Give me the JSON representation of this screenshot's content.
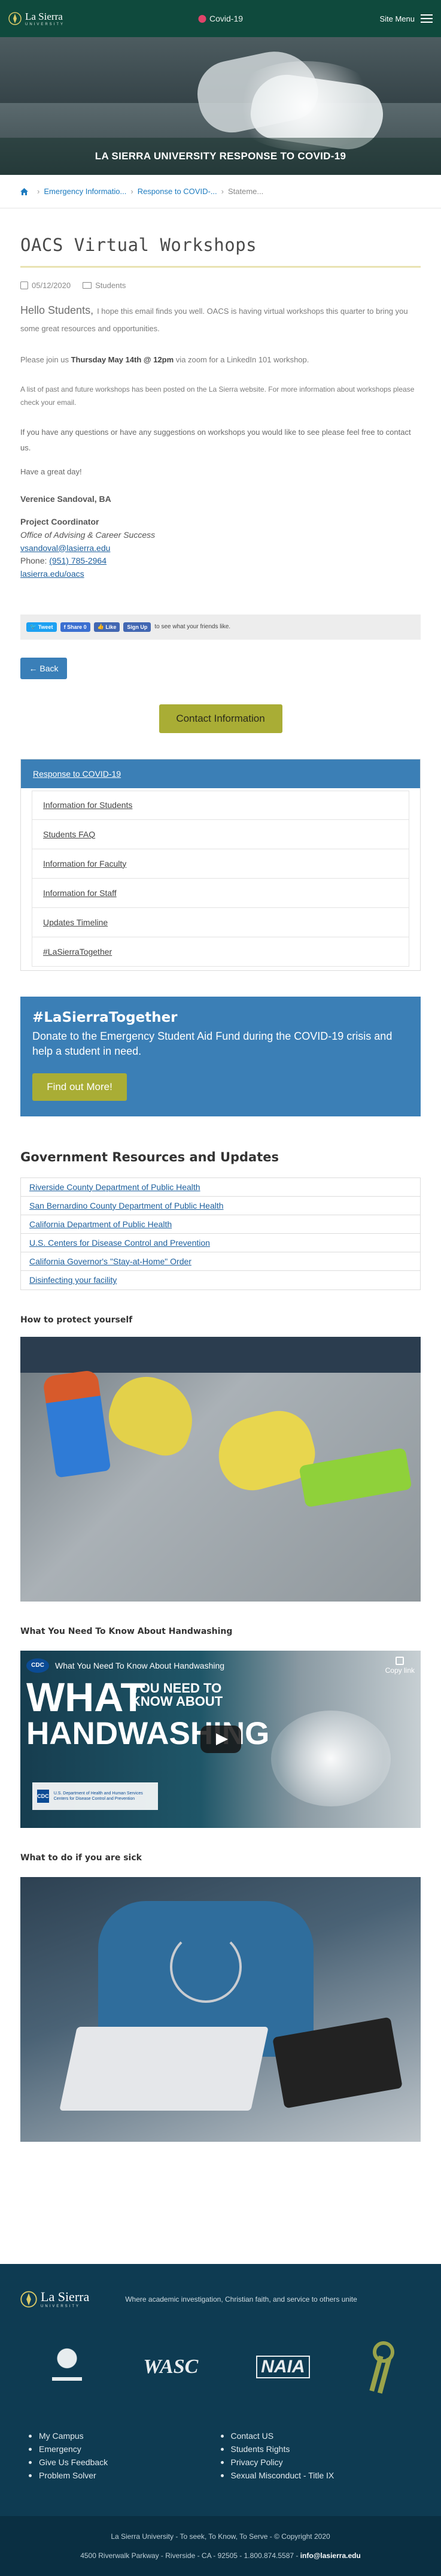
{
  "header": {
    "logo_name": "La Sierra",
    "logo_sub": "UNIVERSITY",
    "covid_label": "Covid-19",
    "menu_label": "Site Menu"
  },
  "hero": {
    "title": "LA SIERRA UNIVERSITY RESPONSE TO COVID-19"
  },
  "breadcrumb": {
    "items": [
      "Emergency Informatio...",
      "Response to COVID-...",
      "Stateme..."
    ]
  },
  "article": {
    "title": "OACS Virtual Workshops",
    "date": "05/12/2020",
    "category": "Students",
    "hello": "Hello Students,",
    "intro": "I hope this email finds you well. OACS is having virtual workshops this quarter to bring you some great resources and opportunities.",
    "join_prefix": "Please join us ",
    "join_bold": "Thursday May 14th @ 12pm",
    "join_suffix": " via zoom for a LinkedIn 101 workshop.",
    "list_text": "A list of past and future workshops has been posted on the La Sierra website. For more information about workshops please check your email.",
    "questions": "If you have any questions or have any suggestions on workshops you would like to see please feel free to contact us.",
    "closing": "Have a great day!",
    "signer": "Verenice Sandoval, BA",
    "role_title": "Project Coordinator",
    "office": "Office of Advising & Career Success",
    "email": "vsandoval@lasierra.edu",
    "phone_label": "Phone: ",
    "phone": "(951) 785-2964",
    "site": "lasierra.edu/oacs"
  },
  "share": {
    "tweet": "Tweet",
    "share": "Share 0",
    "like": "Like",
    "signup": "Sign Up",
    "fb_text": "to see what your friends like."
  },
  "buttons": {
    "back": "← Back",
    "contact": "Contact Information"
  },
  "sidenav": {
    "head": "Response to COVID-19",
    "items": [
      "Information for Students",
      "Students FAQ",
      "Information for Faculty",
      "Information for Staff",
      "Updates Timeline",
      "#LaSierraTogether"
    ]
  },
  "donate": {
    "tag": "#LaSierraTogether",
    "text": "Donate to the Emergency Student Aid Fund during the COVID-19 crisis and help a student in need.",
    "button": "Find out More!"
  },
  "resources": {
    "title": "Government Resources and Updates",
    "items": [
      "Riverside County Department of Public Health",
      "San Bernardino County Department of Public Health",
      "California Department of Public Health",
      "U.S. Centers for Disease Control and Prevention",
      "California Governor's \"Stay-at-Home\" Order",
      "Disinfecting your facility"
    ]
  },
  "sections": {
    "protect": "How to protect yourself",
    "handwash": "What You Need To Know About Handwashing",
    "sick": "What to do if you are sick"
  },
  "video": {
    "channel": "CDC",
    "title": "What You Need To Know About Handwashing",
    "copy_link": "Copy link",
    "big_what": "WHAT",
    "need": "YOU NEED TO KNOW ABOUT",
    "handwashing": "HANDWASHING",
    "cdc_box": "U.S. Department of Health and Human Services Centers for Disease Control and Prevention"
  },
  "footer": {
    "logo_name": "La Sierra",
    "logo_sub": "UNIVERSITY",
    "tagline": "Where academic investigation, Christian faith, and service to others unite",
    "logo_wasc": "WASC",
    "logo_naia": "NAIA",
    "links_left": [
      "My Campus",
      "Emergency",
      "Give Us Feedback",
      "Problem Solver"
    ],
    "links_right": [
      "Contact US",
      "Students Rights",
      "Privacy Policy",
      "Sexual Misconduct - Title IX"
    ],
    "copyright": "La Sierra University - To seek, To Know, To Serve - © Copyright 2020",
    "address": "4500 Riverwalk Parkway - Riverside - CA - 92505 - 1.800.874.5587 - ",
    "email": "info@lasierra.edu"
  },
  "colors": {
    "header_green": "#0f4a3d",
    "accent_blue": "#3b7fb6",
    "accent_olive": "#a9ad35",
    "footer_navy": "#0e3b52"
  }
}
